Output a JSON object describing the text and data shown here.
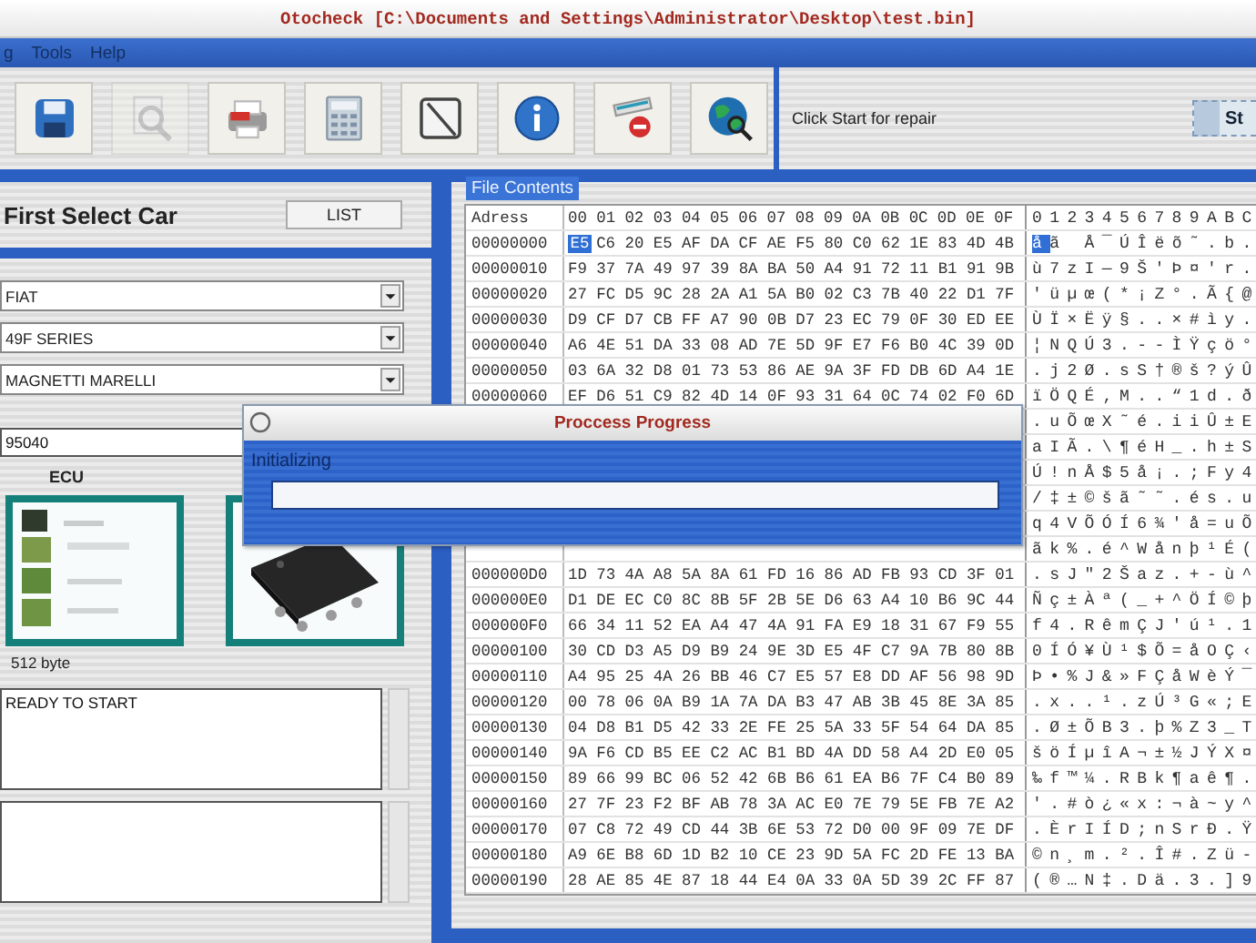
{
  "window": {
    "title": "Otocheck [C:\\Documents and Settings\\Administrator\\Desktop\\test.bin]"
  },
  "menu": [
    "g",
    "Tools",
    "Help"
  ],
  "toolbar": {
    "buttons": [
      {
        "kind": "save",
        "disabled": false
      },
      {
        "kind": "search",
        "disabled": true
      },
      {
        "kind": "print",
        "disabled": false
      },
      {
        "kind": "calculator",
        "disabled": false
      },
      {
        "kind": "note",
        "disabled": false
      },
      {
        "kind": "info",
        "disabled": false
      },
      {
        "kind": "erase",
        "disabled": false
      },
      {
        "kind": "globe",
        "disabled": false
      }
    ],
    "status": "Click Start for repair",
    "start_button": "St"
  },
  "car_panel": {
    "heading": "First Select Car",
    "list_button": "LIST",
    "selects": [
      {
        "value": "FIAT"
      },
      {
        "value": "49F SERIES"
      },
      {
        "value": "MAGNETTI MARELLI"
      }
    ],
    "chip_field": {
      "value": "95040"
    },
    "ecu_label": "ECU",
    "size": "512 byte",
    "log": {
      "value": "READY TO START"
    }
  },
  "file_view": {
    "tab": "File Contents",
    "address_header": "Adress",
    "columns": [
      "00",
      "01",
      "02",
      "03",
      "04",
      "05",
      "06",
      "07",
      "08",
      "09",
      "0A",
      "0B",
      "0C",
      "0D",
      "0E",
      "0F"
    ],
    "ascii_header": "0123456789ABC",
    "rows": [
      {
        "address": "00000000",
        "cursor": "E5",
        "bytes": "C6 20 E5 AF DA CF AE F5 80 C0 62 1E 83 4D 4B",
        "ascii_cursor": "å",
        "ascii": "ã Å¯ÚÎëõ˜.b."
      },
      {
        "address": "00000010",
        "bytes": "F9 37 7A 49 97 39 8A BA 50 A4 91 72 11 B1 91 9B",
        "ascii": "ù7zI—9Š'Þ¤'r."
      },
      {
        "address": "00000020",
        "bytes": "27 FC D5 9C 28 2A A1 5A B0 02 C3 7B 40 22 D1 7F",
        "ascii": "'üµœ(*¡Z°.Ã{@"
      },
      {
        "address": "00000030",
        "bytes": "D9 CF D7 CB FF A7 90 0B D7 23 EC 79 0F 30 ED EE",
        "ascii": "ÙÏ×Ëÿ§..×#ìy."
      },
      {
        "address": "00000040",
        "bytes": "A6 4E 51 DA 33 08 AD 7E 5D 9F E7 F6 B0 4C 39 0D",
        "ascii": "¦NQÚ3.--ÌŸçö°"
      },
      {
        "address": "00000050",
        "bytes": "03 6A 32 D8 01 73 53 86 AE 9A 3F FD DB 6D A4 1E",
        "ascii": ".j2Ø.sS†®š?ýÛ"
      },
      {
        "address": "00000060",
        "bytes": "EF D6 51 C9 82 4D 14 0F 93 31 64 0C 74 02 F0 6D",
        "ascii": "ïÖQÉ‚M..“1d.ð"
      },
      {
        "ascii": ".uÕœX˜é.iiÛ±E"
      },
      {
        "ascii": "aIÃ.\\¶éH_.h±S"
      },
      {
        "ascii": "Ú!nÅ$5å¡.;Fy4"
      },
      {
        "ascii": "/‡±©šã˜˜.és.u"
      },
      {
        "ascii": "q4VÕÓÍ6¾'å=uÕ"
      },
      {
        "ascii": "ãk%.é^Wånþ¹É("
      },
      {
        "address": "000000D0",
        "bytes": "1D 73 4A A8 5A 8A 61 FD 16 86 AD FB 93 CD 3F 01",
        "ascii": ".sJ\"2Šaz.+-ù^"
      },
      {
        "address": "000000E0",
        "bytes": "D1 DE EC C0 8C 8B 5F 2B 5E D6 63 A4 10 B6 9C 44",
        "ascii": "Ñç±Àª(_+^ÖÍ©þ"
      },
      {
        "address": "000000F0",
        "bytes": "66 34 11 52 EA A4 47 4A 91 FA E9 18 31 67 F9 55",
        "ascii": "f4.RêmÇJ'ú¹.1"
      },
      {
        "address": "00000100",
        "bytes": "30 CD D3 A5 D9 B9 24 9E 3D E5 4F C7 9A 7B 80 8B",
        "ascii": "0ÍÓ¥Ù¹$Õ=åOÇ‹"
      },
      {
        "address": "00000110",
        "bytes": "A4 95 25 4A 26 BB 46 C7 E5 57 E8 DD AF 56 98 9D",
        "ascii": "Þ•%J&»FÇåWèÝ¯"
      },
      {
        "address": "00000120",
        "bytes": "00 78 06 0A B9 1A 7A DA B3 47 AB 3B 45 8E 3A 85",
        "ascii": ".x..¹.zÚ³G«;E"
      },
      {
        "address": "00000130",
        "bytes": "04 D8 B1 D5 42 33 2E FE 25 5A 33 5F 54 64 DA 85",
        "ascii": ".Ø±ÕB3.þ%Z3_T"
      },
      {
        "address": "00000140",
        "bytes": "9A F6 CD B5 EE C2 AC B1 BD 4A DD 58 A4 2D E0 05",
        "ascii": "šöÍµîA¬±½JÝX¤"
      },
      {
        "address": "00000150",
        "bytes": "89 66 99 BC 06 52 42 6B B6 61 EA B6 7F C4 B0 89",
        "ascii": "‰f™¼.RBk¶aê¶."
      },
      {
        "address": "00000160",
        "bytes": "27 7F 23 F2 BF AB 78 3A AC E0 7E 79 5E FB 7E A2",
        "ascii": "'.#ò¿«x:¬à~y^"
      },
      {
        "address": "00000170",
        "bytes": "07 C8 72 49 CD 44 3B 6E 53 72 D0 00 9F 09 7E DF",
        "ascii": ".ÈrIÍD;nSrÐ.Ÿ"
      },
      {
        "address": "00000180",
        "bytes": "A9 6E B8 6D 1D B2 10 CE 23 9D 5A FC 2D FE 13 BA",
        "ascii": "©n¸m.².Î#.Zü-"
      },
      {
        "address": "00000190",
        "bytes": "28 AE 85 4E 87 18 44 E4 0A 33 0A 5D 39 2C FF 87",
        "ascii": "(®…N‡.Dä.3.]9"
      }
    ]
  },
  "dialog": {
    "title": "Proccess Progress",
    "message": "Initializing",
    "progress": {
      "level": 0
    }
  }
}
